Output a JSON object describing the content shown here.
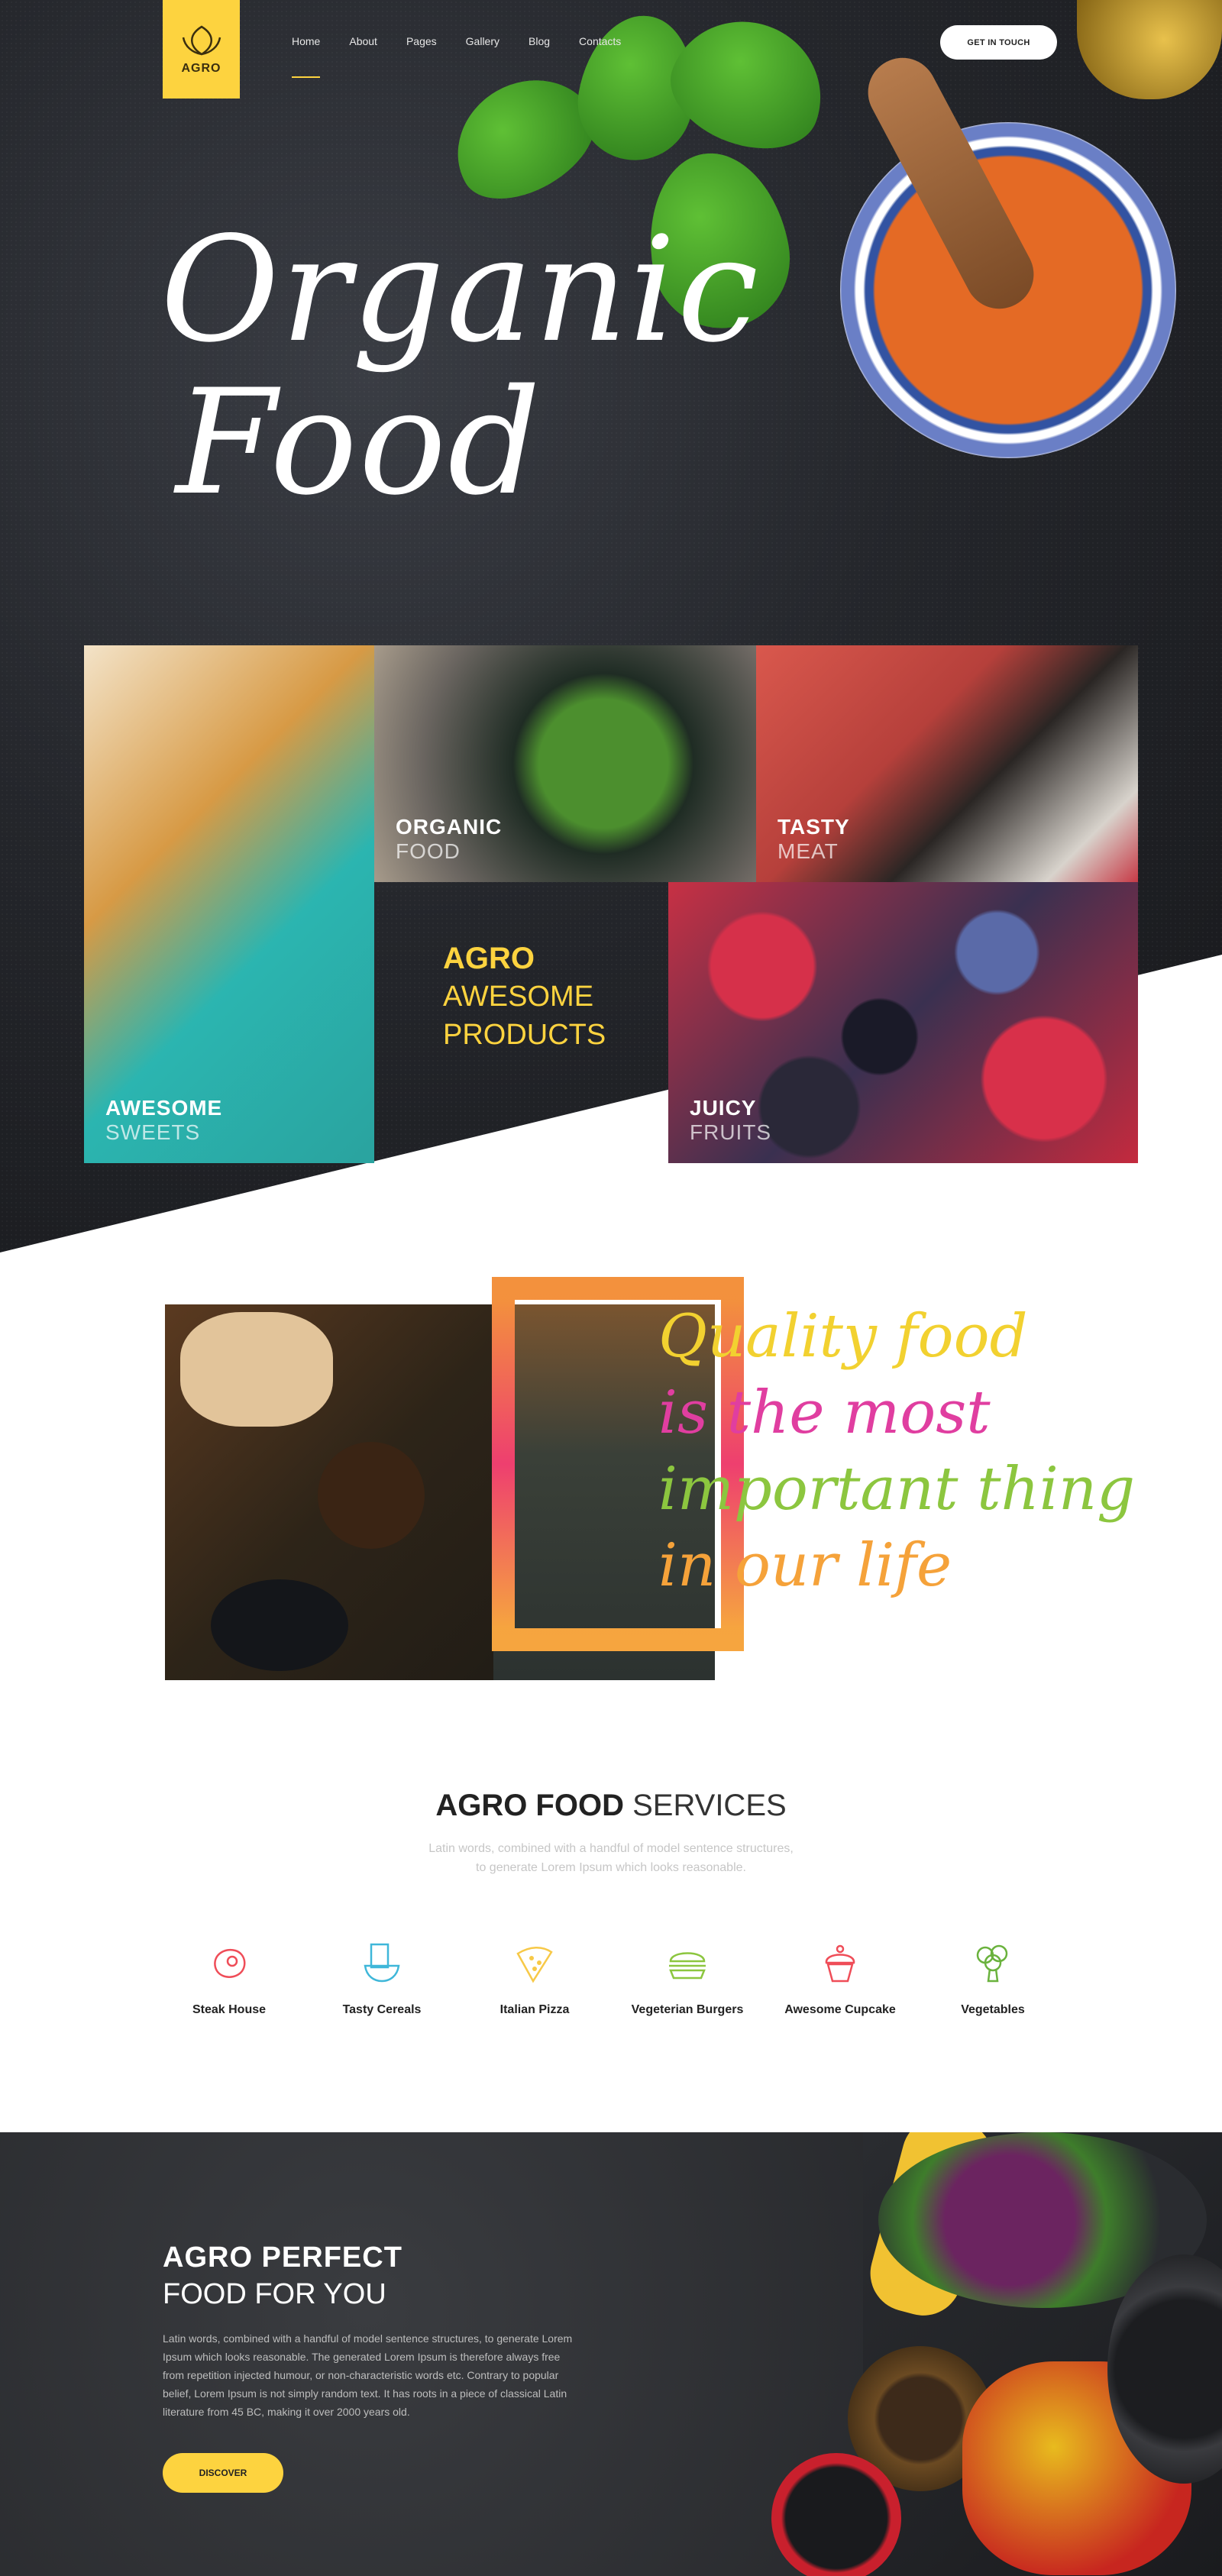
{
  "header": {
    "logo_text": "AGRO",
    "nav": [
      "Home",
      "About",
      "Pages",
      "Gallery",
      "Blog",
      "Contacts"
    ],
    "cta": "GET IN TOUCH"
  },
  "hero": {
    "title_line1": "Organic",
    "title_line2": "Food"
  },
  "products": {
    "tiles": [
      {
        "title": "AWESOME",
        "subtitle": "SWEETS"
      },
      {
        "title": "ORGANIC",
        "subtitle": "FOOD"
      },
      {
        "title": "TASTY",
        "subtitle": "MEAT"
      },
      {
        "title": "JUICY",
        "subtitle": "FRUITS"
      }
    ],
    "center_title": "AGRO",
    "center_line2": "AWESOME",
    "center_line3": "PRODUCTS"
  },
  "quality": {
    "lines": [
      {
        "text": "Quality food",
        "color": "#f2d130"
      },
      {
        "text": "is the most",
        "color": "#e03ea0"
      },
      {
        "text": "important thing",
        "color": "#8cc63f"
      },
      {
        "text": "in our life",
        "color": "#f5a23a"
      }
    ]
  },
  "services": {
    "title_bold": "AGRO FOOD",
    "title_light": "SERVICES",
    "desc_line1": "Latin words, combined with a handful of model sentence structures,",
    "desc_line2": "to generate Lorem Ipsum which looks reasonable.",
    "items": [
      {
        "label": "Steak House",
        "icon": "steak-icon",
        "color": "#ef4d58"
      },
      {
        "label": "Tasty Cereals",
        "icon": "cereal-icon",
        "color": "#3fb7d9"
      },
      {
        "label": "Italian Pizza",
        "icon": "pizza-icon",
        "color": "#f7c948"
      },
      {
        "label": "Vegeterian Burgers",
        "icon": "burger-icon",
        "color": "#8cc63f"
      },
      {
        "label": "Awesome Cupcake",
        "icon": "cupcake-icon",
        "color": "#ef4d58"
      },
      {
        "label": "Vegetables",
        "icon": "broccoli-icon",
        "color": "#6ab23d"
      }
    ]
  },
  "perfect": {
    "title_bold": "AGRO PERFECT",
    "title_light": "FOOD FOR YOU",
    "desc": "Latin words, combined with a handful of model sentence structures, to generate Lorem Ipsum which looks reasonable. The generated Lorem Ipsum is therefore always free from repetition injected humour, or non-characteristic words etc. Contrary to popular belief, Lorem Ipsum is not simply random text. It has roots in a piece of classical Latin literature from 45 BC, making it over 2000 years old.",
    "cta": "DISCOVER"
  },
  "colors": {
    "accent": "#fdd33f",
    "dark": "#24262b"
  }
}
